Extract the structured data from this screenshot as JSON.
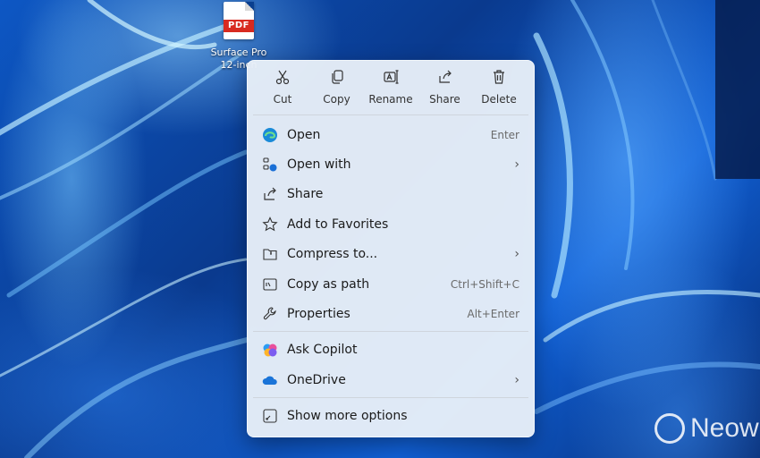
{
  "desktop": {
    "file": {
      "badge": "PDF",
      "label_line1": "Surface Pro",
      "label_line2": "12-inch"
    },
    "watermark": "Neow"
  },
  "context_menu": {
    "toolbar": [
      {
        "label": "Cut",
        "icon": "scissors-icon"
      },
      {
        "label": "Copy",
        "icon": "copy-icon"
      },
      {
        "label": "Rename",
        "icon": "rename-icon"
      },
      {
        "label": "Share",
        "icon": "share-icon"
      },
      {
        "label": "Delete",
        "icon": "trash-icon"
      }
    ],
    "items": [
      {
        "label": "Open",
        "shortcut": "Enter",
        "icon": "edge-icon"
      },
      {
        "label": "Open with",
        "submenu": true,
        "icon": "open-with-icon"
      },
      {
        "label": "Share",
        "icon": "share-icon"
      },
      {
        "label": "Add to Favorites",
        "icon": "star-icon"
      },
      {
        "label": "Compress to...",
        "submenu": true,
        "icon": "zip-folder-icon"
      },
      {
        "label": "Copy as path",
        "shortcut": "Ctrl+Shift+C",
        "icon": "copy-path-icon"
      },
      {
        "label": "Properties",
        "shortcut": "Alt+Enter",
        "icon": "wrench-icon"
      },
      {
        "label": "Ask Copilot",
        "icon": "copilot-icon"
      },
      {
        "label": "OneDrive",
        "submenu": true,
        "icon": "onedrive-icon"
      },
      {
        "label": "Show more options",
        "icon": "more-options-icon"
      }
    ],
    "chevron": "›"
  }
}
